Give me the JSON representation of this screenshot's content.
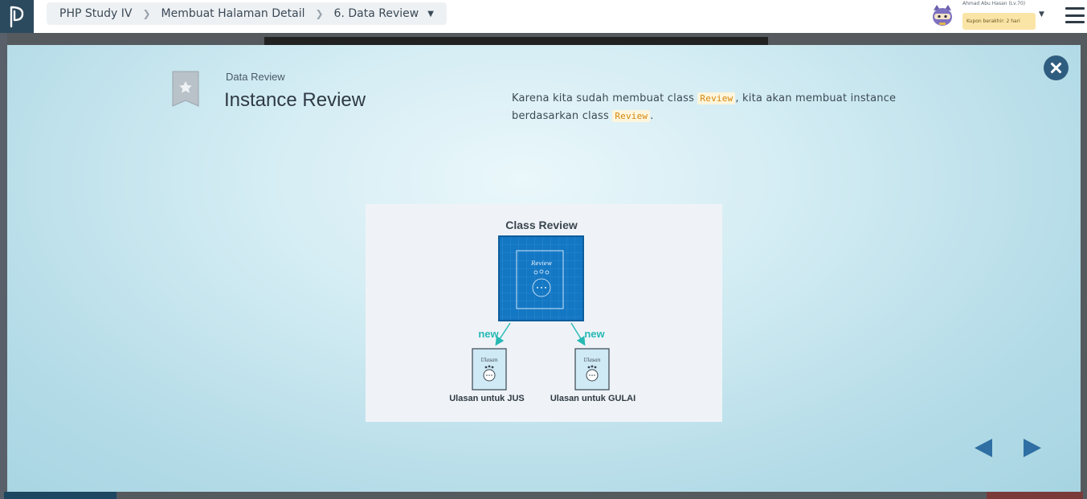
{
  "breadcrumb": {
    "course": "PHP Study IV",
    "chapter": "Membuat Halaman Detail",
    "lesson": "6. Data Review"
  },
  "user": {
    "name": "Ahmad Abu Hasan (Lv.70)",
    "coupon": "Kupon berakhir: 2 hari"
  },
  "icons": {
    "logo": "progate-logo-icon",
    "avatar": "ninja-cat-avatar-icon",
    "menu": "hamburger-menu-icon",
    "close": "close-circle-icon",
    "bookmark": "bookmark-star-icon",
    "prev": "triangle-left-icon",
    "next": "triangle-right-icon"
  },
  "colors": {
    "accent": "#2f5d80",
    "code_text": "#d4860d",
    "code_bg": "#fdf5dc",
    "blueprint": "#1477c4",
    "arrow": "#27b9b4"
  },
  "slide": {
    "label": "Data Review",
    "title": "Instance Review",
    "description": {
      "part1": "Karena kita sudah membuat class ",
      "code1": "Review",
      "part2": ", kita akan membuat instance berdasarkan class ",
      "code2": "Review",
      "part3": "."
    }
  },
  "figure": {
    "title": "Class Review",
    "class_card_label": "Review",
    "arrow_label_left": "new",
    "arrow_label_right": "new",
    "instance_card_label_left": "Ulasan",
    "instance_card_label_right": "Ulasan",
    "caption_left": "Ulasan untuk JUS",
    "caption_right": "Ulasan untuk GULAI"
  }
}
